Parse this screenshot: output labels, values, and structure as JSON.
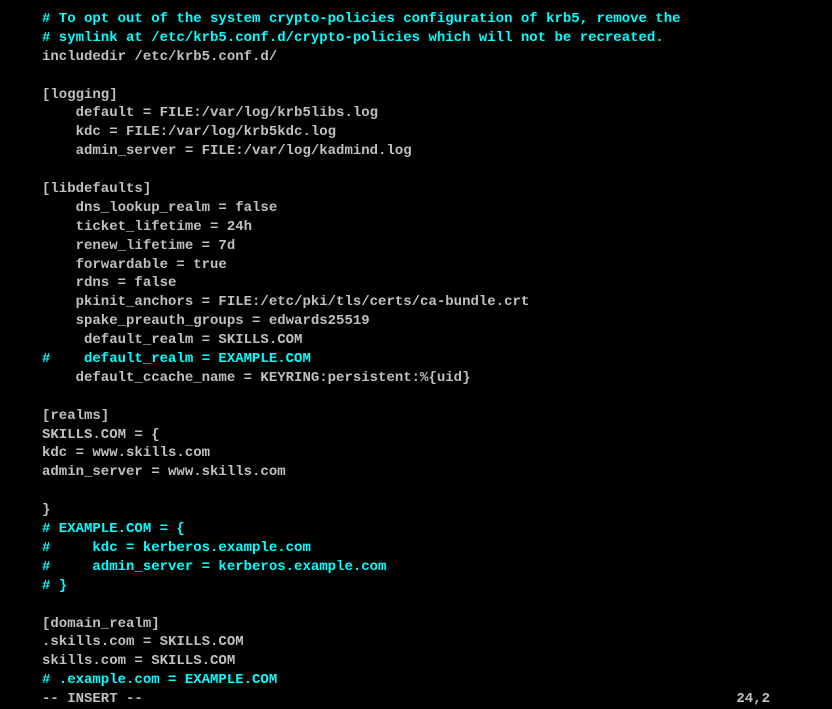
{
  "lines": {
    "l1": "# To opt out of the system crypto-policies configuration of krb5, remove the",
    "l2": "# symlink at /etc/krb5.conf.d/crypto-policies which will not be recreated.",
    "l3": "includedir /etc/krb5.conf.d/",
    "l4": "",
    "l5": "[logging]",
    "l6": "    default = FILE:/var/log/krb5libs.log",
    "l7": "    kdc = FILE:/var/log/krb5kdc.log",
    "l8": "    admin_server = FILE:/var/log/kadmind.log",
    "l9": "",
    "l10": "[libdefaults]",
    "l11": "    dns_lookup_realm = false",
    "l12": "    ticket_lifetime = 24h",
    "l13": "    renew_lifetime = 7d",
    "l14": "    forwardable = true",
    "l15": "    rdns = false",
    "l16": "    pkinit_anchors = FILE:/etc/pki/tls/certs/ca-bundle.crt",
    "l17": "    spake_preauth_groups = edwards25519",
    "l18": "     default_realm = SKILLS.COM",
    "l19": "#    default_realm = EXAMPLE.COM",
    "l20": "    default_ccache_name = KEYRING:persistent:%{uid}",
    "l21": "",
    "l22": "[realms]",
    "l23": "SKILLS.COM = {",
    "l24": "kdc = www.skills.com",
    "l25": "admin_server = www.skills.com",
    "l26": "",
    "l27": "}",
    "l28": "# EXAMPLE.COM = {",
    "l29": "#     kdc = kerberos.example.com",
    "l30": "#     admin_server = kerberos.example.com",
    "l31": "# }",
    "l32": "",
    "l33": "[domain_realm]",
    "l34": ".skills.com = SKILLS.COM",
    "l35": "skills.com = SKILLS.COM",
    "l36": "# .example.com = EXAMPLE.COM"
  },
  "status": {
    "mode": "-- INSERT --",
    "position": "24,2"
  }
}
